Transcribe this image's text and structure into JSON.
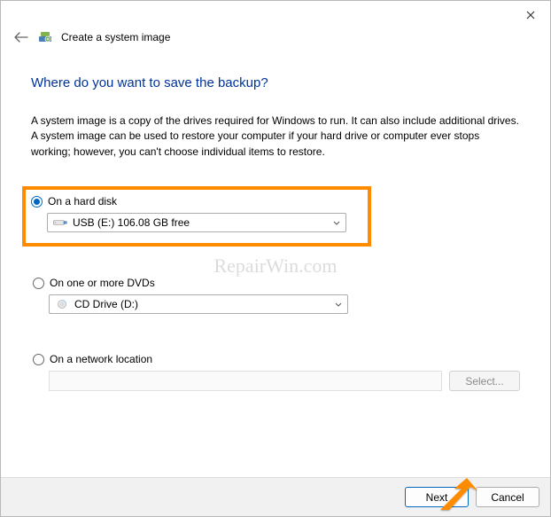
{
  "window": {
    "title": "Create a system image"
  },
  "page": {
    "title": "Where do you want to save the backup?",
    "description": "A system image is a copy of the drives required for Windows to run. It can also include additional drives. A system image can be used to restore your computer if your hard drive or computer ever stops working; however, you can't choose individual items to restore."
  },
  "options": {
    "hard_disk": {
      "label": "On a hard disk",
      "selected_value": "USB (E:)  106.08 GB free",
      "checked": true
    },
    "dvd": {
      "label": "On one or more DVDs",
      "selected_value": "CD Drive (D:)",
      "checked": false
    },
    "network": {
      "label": "On a network location",
      "select_button": "Select...",
      "checked": false
    }
  },
  "footer": {
    "next": "Next",
    "cancel": "Cancel"
  },
  "watermark": "RepairWin.com"
}
